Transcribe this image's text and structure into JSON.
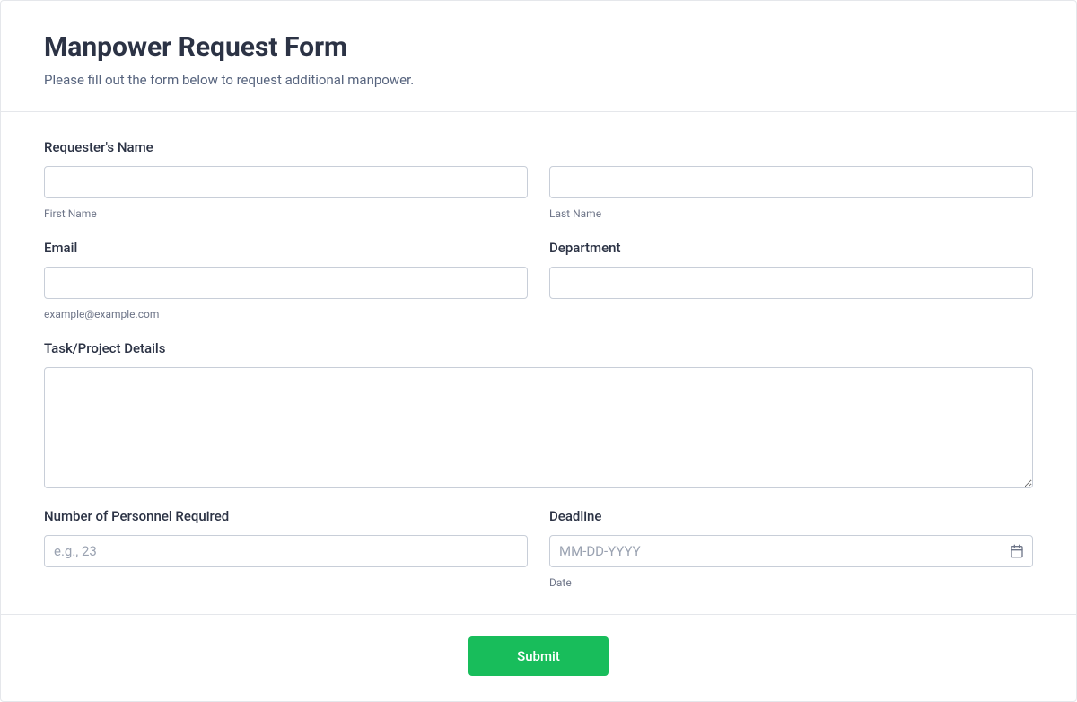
{
  "header": {
    "title": "Manpower Request Form",
    "subtitle": "Please fill out the form below to request additional manpower."
  },
  "fields": {
    "requester_name_label": "Requester's Name",
    "first_name_sublabel": "First Name",
    "last_name_sublabel": "Last Name",
    "email_label": "Email",
    "email_hint": "example@example.com",
    "department_label": "Department",
    "task_label": "Task/Project Details",
    "personnel_label": "Number of Personnel Required",
    "personnel_placeholder": "e.g., 23",
    "deadline_label": "Deadline",
    "deadline_placeholder": "MM-DD-YYYY",
    "deadline_sublabel": "Date"
  },
  "actions": {
    "submit": "Submit"
  }
}
